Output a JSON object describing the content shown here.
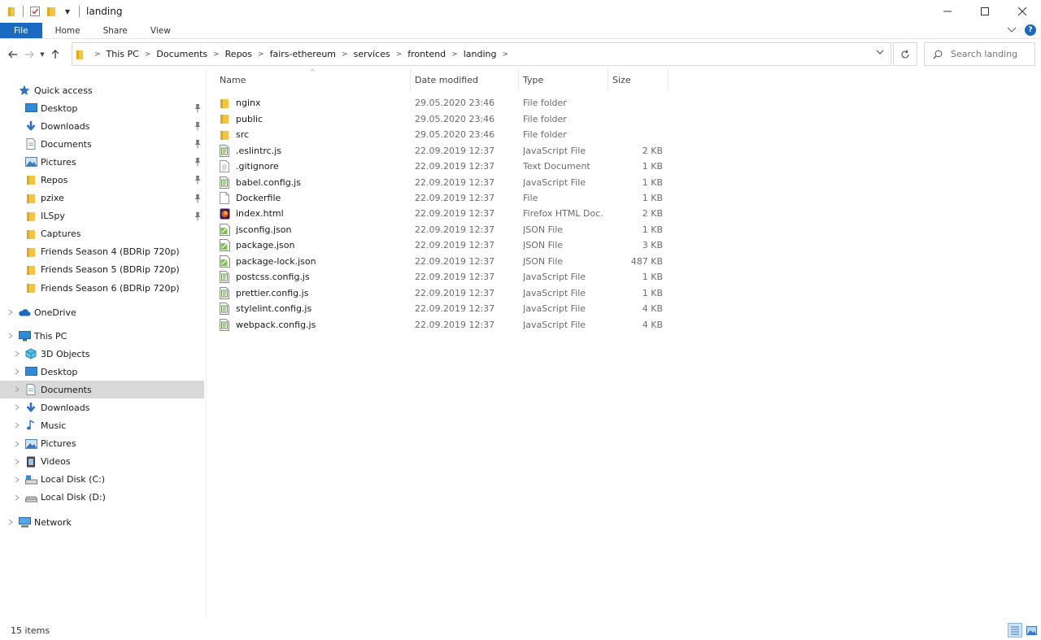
{
  "window": {
    "title": "landing"
  },
  "ribbon": {
    "tabs": [
      {
        "label": "File"
      },
      {
        "label": "Home"
      },
      {
        "label": "Share"
      },
      {
        "label": "View"
      }
    ]
  },
  "address": {
    "breadcrumbs": [
      "This PC",
      "Documents",
      "Repos",
      "fairs-ethereum",
      "services",
      "frontend",
      "landing"
    ]
  },
  "search": {
    "placeholder": "Search landing"
  },
  "sidebar": {
    "quick_access": {
      "label": "Quick access",
      "items": [
        {
          "label": "Desktop",
          "icon": "desktop-icon",
          "pinned": true
        },
        {
          "label": "Downloads",
          "icon": "downloads-icon",
          "pinned": true
        },
        {
          "label": "Documents",
          "icon": "documents-icon",
          "pinned": true
        },
        {
          "label": "Pictures",
          "icon": "pictures-icon",
          "pinned": true
        },
        {
          "label": "Repos",
          "icon": "folder-icon",
          "pinned": true
        },
        {
          "label": "pzixe",
          "icon": "folder-icon",
          "pinned": true
        },
        {
          "label": "ILSpy",
          "icon": "folder-icon",
          "pinned": true
        },
        {
          "label": "Captures",
          "icon": "folder-icon",
          "pinned": false
        },
        {
          "label": "Friends Season 4 (BDRip 720p)",
          "icon": "folder-icon",
          "pinned": false
        },
        {
          "label": "Friends Season 5 (BDRip 720p)",
          "icon": "folder-icon",
          "pinned": false
        },
        {
          "label": "Friends Season 6 (BDRip 720p)",
          "icon": "folder-icon",
          "pinned": false
        }
      ]
    },
    "onedrive": {
      "label": "OneDrive"
    },
    "this_pc": {
      "label": "This PC",
      "items": [
        {
          "label": "3D Objects",
          "icon": "3d-objects-icon"
        },
        {
          "label": "Desktop",
          "icon": "desktop-icon"
        },
        {
          "label": "Documents",
          "icon": "documents-icon",
          "selected": true
        },
        {
          "label": "Downloads",
          "icon": "downloads-icon"
        },
        {
          "label": "Music",
          "icon": "music-icon"
        },
        {
          "label": "Pictures",
          "icon": "pictures-icon"
        },
        {
          "label": "Videos",
          "icon": "videos-icon"
        },
        {
          "label": "Local Disk (C:)",
          "icon": "drive-c-icon"
        },
        {
          "label": "Local Disk (D:)",
          "icon": "drive-icon"
        }
      ]
    },
    "network": {
      "label": "Network"
    }
  },
  "columns": {
    "name": "Name",
    "date": "Date modified",
    "type": "Type",
    "size": "Size"
  },
  "files": [
    {
      "name": "nginx",
      "date": "29.05.2020 23:46",
      "type": "File folder",
      "size": "",
      "icon": "folder-icon"
    },
    {
      "name": "public",
      "date": "29.05.2020 23:46",
      "type": "File folder",
      "size": "",
      "icon": "folder-icon"
    },
    {
      "name": "src",
      "date": "29.05.2020 23:46",
      "type": "File folder",
      "size": "",
      "icon": "folder-icon"
    },
    {
      "name": ".eslintrc.js",
      "date": "22.09.2019 12:37",
      "type": "JavaScript File",
      "size": "2 KB",
      "icon": "js-file-icon"
    },
    {
      "name": ".gitignore",
      "date": "22.09.2019 12:37",
      "type": "Text Document",
      "size": "1 KB",
      "icon": "text-file-icon"
    },
    {
      "name": "babel.config.js",
      "date": "22.09.2019 12:37",
      "type": "JavaScript File",
      "size": "1 KB",
      "icon": "js-file-icon"
    },
    {
      "name": "Dockerfile",
      "date": "22.09.2019 12:37",
      "type": "File",
      "size": "1 KB",
      "icon": "blank-file-icon"
    },
    {
      "name": "index.html",
      "date": "22.09.2019 12:37",
      "type": "Firefox HTML Doc...",
      "size": "2 KB",
      "icon": "html-file-icon"
    },
    {
      "name": "jsconfig.json",
      "date": "22.09.2019 12:37",
      "type": "JSON File",
      "size": "1 KB",
      "icon": "json-file-icon"
    },
    {
      "name": "package.json",
      "date": "22.09.2019 12:37",
      "type": "JSON File",
      "size": "3 KB",
      "icon": "json-file-icon"
    },
    {
      "name": "package-lock.json",
      "date": "22.09.2019 12:37",
      "type": "JSON File",
      "size": "487 KB",
      "icon": "json-file-icon"
    },
    {
      "name": "postcss.config.js",
      "date": "22.09.2019 12:37",
      "type": "JavaScript File",
      "size": "1 KB",
      "icon": "js-file-icon"
    },
    {
      "name": "prettier.config.js",
      "date": "22.09.2019 12:37",
      "type": "JavaScript File",
      "size": "1 KB",
      "icon": "js-file-icon"
    },
    {
      "name": "stylelint.config.js",
      "date": "22.09.2019 12:37",
      "type": "JavaScript File",
      "size": "4 KB",
      "icon": "js-file-icon"
    },
    {
      "name": "webpack.config.js",
      "date": "22.09.2019 12:37",
      "type": "JavaScript File",
      "size": "4 KB",
      "icon": "js-file-icon"
    }
  ],
  "status": {
    "count": "15 items"
  },
  "colors": {
    "accent": "#1b6ac2",
    "folder": "#f5c542",
    "selection": "#d9d9d9"
  }
}
